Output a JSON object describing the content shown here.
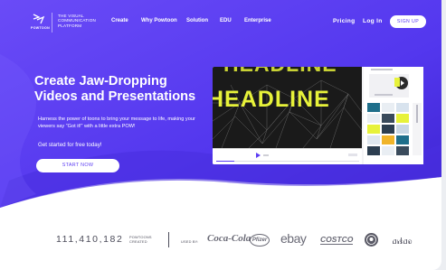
{
  "brand": {
    "logo_word": "POWTOON",
    "tagline": "THE VISUAL COMMUNICATION PLATFORM"
  },
  "nav": {
    "items": [
      "Create",
      "Why Powtoon",
      "Solution",
      "EDU",
      "Enterprise"
    ],
    "pricing": "Pricing",
    "login": "Log In",
    "signup": "SIGN UP"
  },
  "hero": {
    "headline_1": "Create Jaw-Dropping",
    "headline_2": "Videos and Presentations",
    "subtext": "Harness the power of toons to bring your message to life, making your viewers say “Got it!” with a little extra POW!",
    "free": "Get started for free today!",
    "cta": "START NOW"
  },
  "editor": {
    "canvas_line_1": "HEADLINE",
    "canvas_line_2": "HEADLINE"
  },
  "stats": {
    "count": "111,410,182",
    "count_label_1": "POWTOONS",
    "count_label_2": "CREATED",
    "used_by": "USED BY:",
    "brands": [
      "Coca-Cola",
      "Pfizer",
      "ebay",
      "COSTCO",
      "Starbucks",
      "CISCO"
    ]
  },
  "colors": {
    "hero_primary": "#5b3cf3",
    "hero_dark": "#3a22c9",
    "accent_yellow": "#e7f23a"
  }
}
